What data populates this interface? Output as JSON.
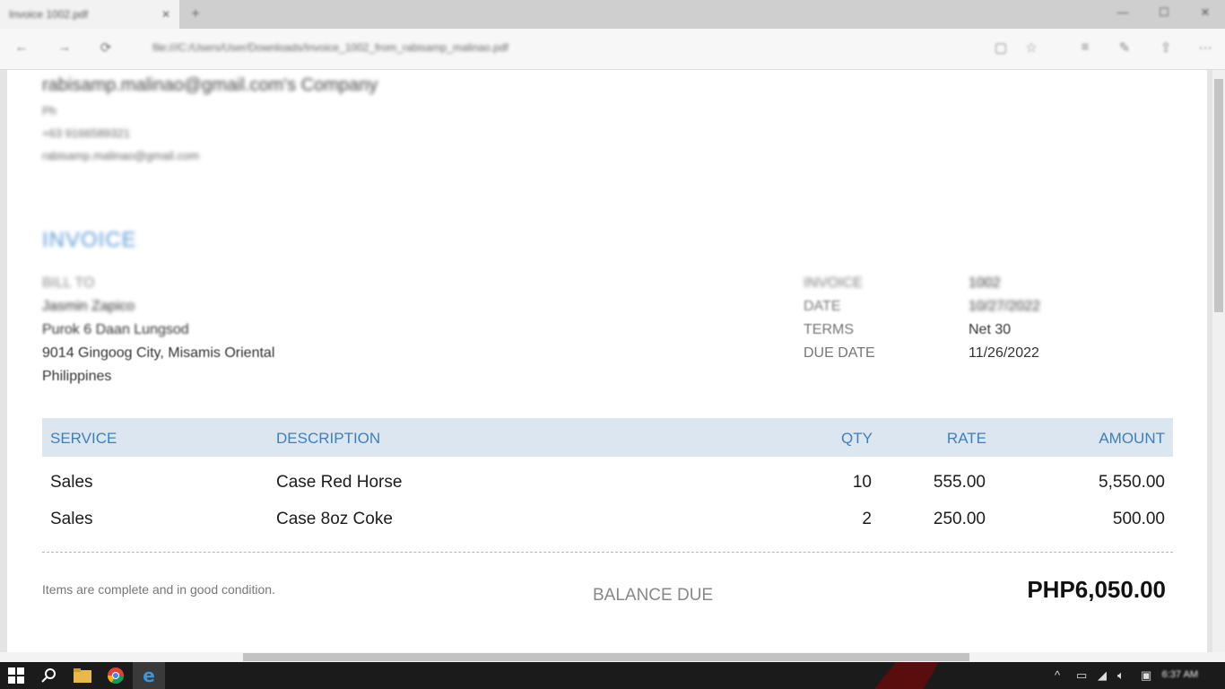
{
  "browser": {
    "tab_title": "Invoice 1002.pdf",
    "tab_close": "✕",
    "new_tab": "+",
    "url": "file:///C:/Users/User/Downloads/Invoice_1002_from_rabisamp_malinao.pdf",
    "window_controls": [
      "—",
      "☐",
      "✕"
    ]
  },
  "company": {
    "name": "rabisamp.malinao@gmail.com's Company",
    "address": "Ph",
    "phone": "+63 9166589321",
    "email": "rabisamp.malinao@gmail.com"
  },
  "invoice": {
    "title": "INVOICE",
    "bill_to_label": "BILL TO",
    "bill_to_lines": [
      "Jasmin Zapico",
      "Purok 6 Daan Lungsod",
      "9014 Gingoog City, Misamis Oriental",
      "Philippines"
    ],
    "meta": [
      {
        "label": "INVOICE",
        "value": "1002"
      },
      {
        "label": "DATE",
        "value": "10/27/2022"
      },
      {
        "label": "TERMS",
        "value": "Net 30"
      },
      {
        "label": "DUE DATE",
        "value": "11/26/2022"
      }
    ],
    "columns": {
      "service": "SERVICE",
      "description": "DESCRIPTION",
      "qty": "QTY",
      "rate": "RATE",
      "amount": "AMOUNT"
    },
    "items": [
      {
        "service": "Sales",
        "description": "Case Red Horse",
        "qty": "10",
        "rate": "555.00",
        "amount": "5,550.00"
      },
      {
        "service": "Sales",
        "description": "Case 8oz Coke",
        "qty": "2",
        "rate": "250.00",
        "amount": "500.00"
      }
    ],
    "note": "Items  are complete and in good condition.",
    "balance_due_label": "BALANCE DUE",
    "balance_due_value": "PHP6,050.00"
  },
  "taskbar": {
    "clock": "6:37 AM",
    "tray_chevron": "^"
  },
  "colors": {
    "accent": "#5b9bd5",
    "table_header_bg": "#dce6f0",
    "table_header_text": "#3e7fb9"
  }
}
